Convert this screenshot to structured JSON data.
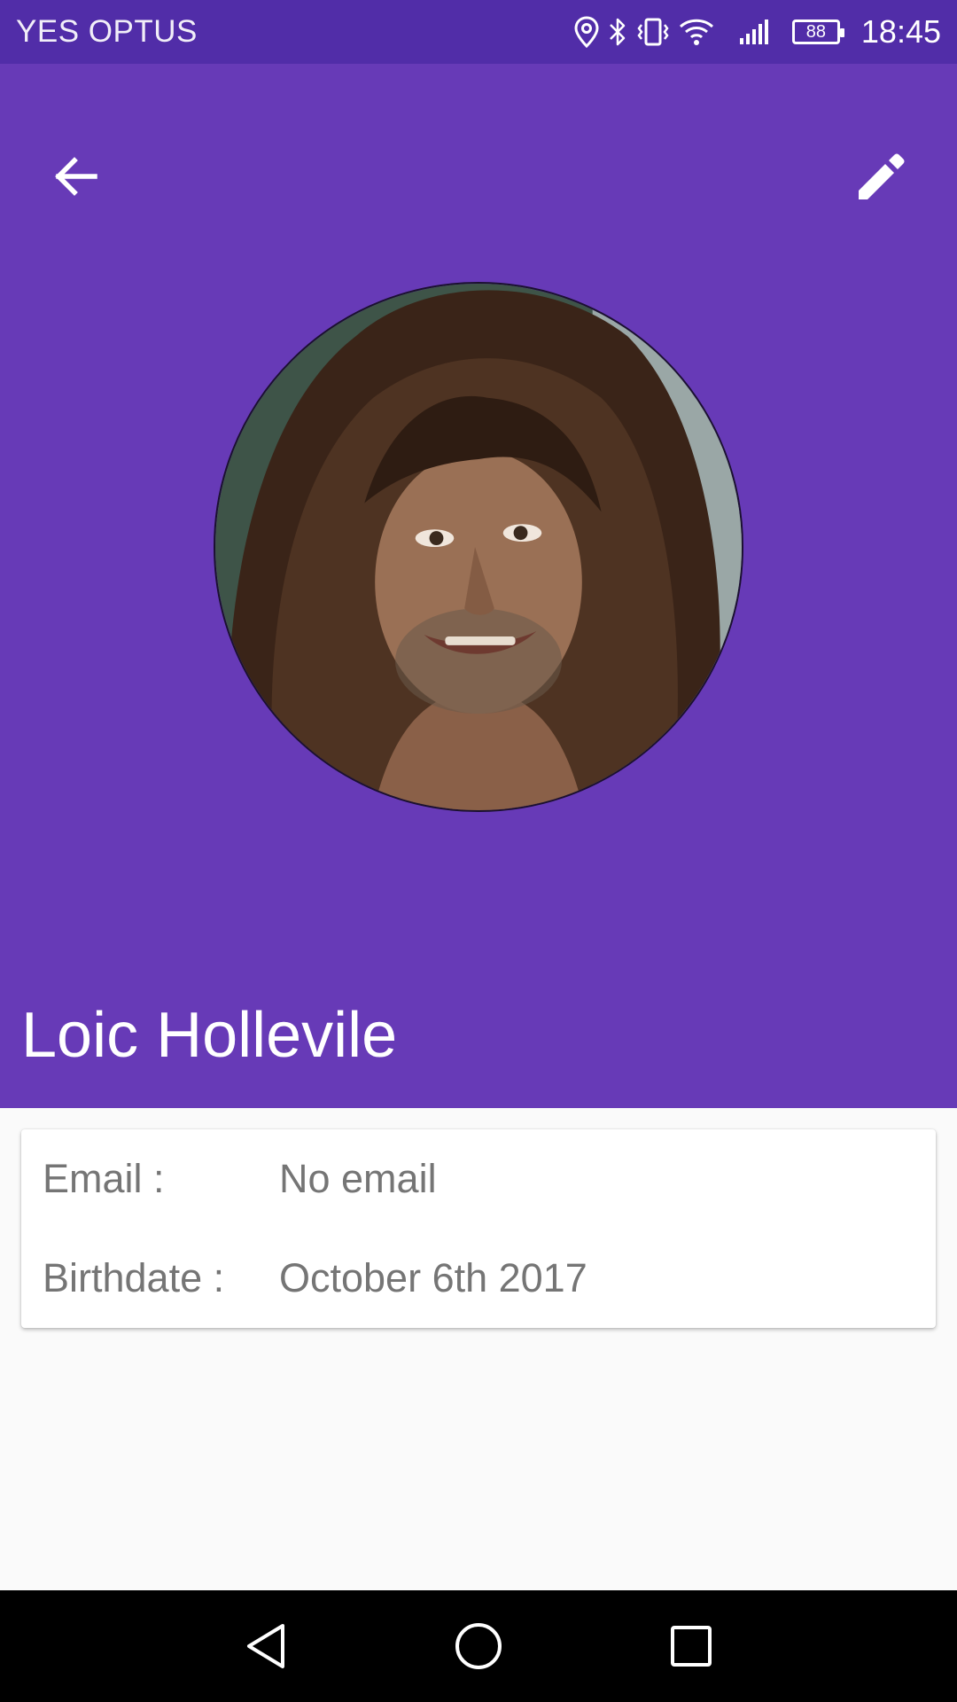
{
  "status_bar": {
    "carrier": "YES OPTUS",
    "battery_level": "88",
    "time": "18:45",
    "icons": [
      "location-icon",
      "bluetooth-icon",
      "vibrate-icon",
      "wifi-icon",
      "signal-icon",
      "battery-icon"
    ]
  },
  "app_bar": {
    "back_icon": "arrow-back-icon",
    "edit_icon": "pencil-icon"
  },
  "profile": {
    "name": "Loic Hollevile",
    "avatar": "profile-photo"
  },
  "details": {
    "email_label": "Email :",
    "email_value": "No email",
    "birthdate_label": "Birthdate :",
    "birthdate_value": "October 6th 2017"
  },
  "navigation": {
    "icons": [
      "back-triangle-icon",
      "home-circle-icon",
      "recents-square-icon"
    ]
  },
  "colors": {
    "status_bar": "#512da8",
    "primary": "#673ab7",
    "background": "#fafafa",
    "card": "#ffffff",
    "text_secondary": "#757575",
    "nav_bar": "#000000"
  }
}
